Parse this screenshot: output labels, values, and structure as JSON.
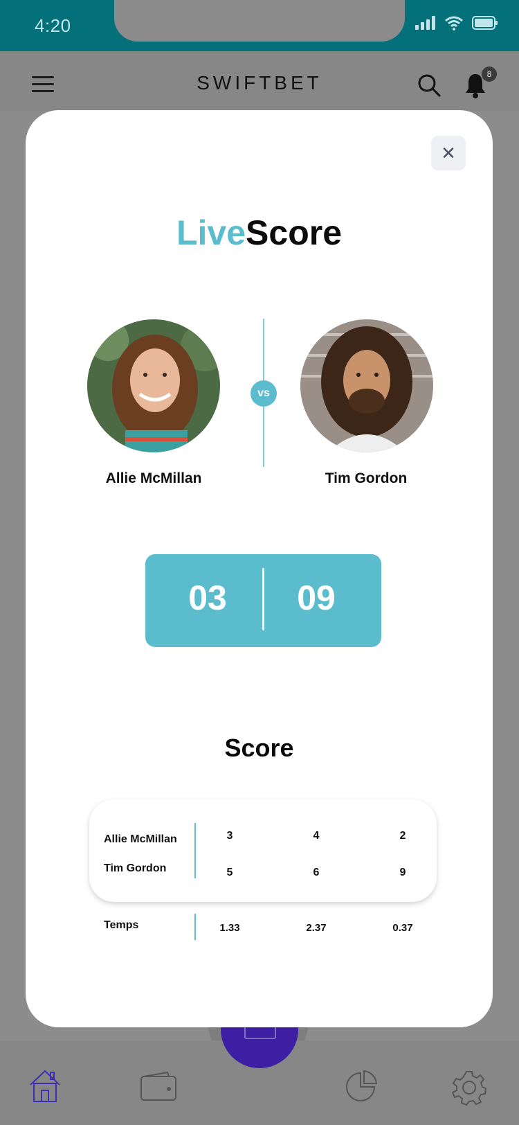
{
  "status_bar": {
    "time": "4:20"
  },
  "header": {
    "brand": "SWIFTBET",
    "notification_count": "8"
  },
  "modal": {
    "close_symbol": "✕",
    "title_accent": "Live",
    "title_rest": "Score",
    "vs_label": "vs",
    "players": [
      {
        "name": "Allie McMillan"
      },
      {
        "name": "Tim Gordon"
      }
    ],
    "scoreboard": {
      "left": "03",
      "right": "09"
    },
    "section_title": "Score",
    "rounds": [
      {
        "player": "Allie McMillan",
        "scores": [
          "3",
          "4",
          "2"
        ]
      },
      {
        "player": "Tim Gordon",
        "scores": [
          "5",
          "6",
          "9"
        ]
      }
    ],
    "temps": {
      "label": "Temps",
      "values": [
        "1.33",
        "2.37",
        "0.37"
      ]
    }
  },
  "bottom_nav": {
    "items": [
      {
        "icon": "home-icon"
      },
      {
        "icon": "wallet-icon"
      },
      {
        "icon": "bet-slip-icon"
      },
      {
        "icon": "stats-icon"
      },
      {
        "icon": "settings-icon"
      }
    ]
  },
  "colors": {
    "accent": "#5bbccd",
    "status_bar": "#04707a",
    "fab": "#3e1fa3",
    "overlay": "#8c8c8c"
  }
}
